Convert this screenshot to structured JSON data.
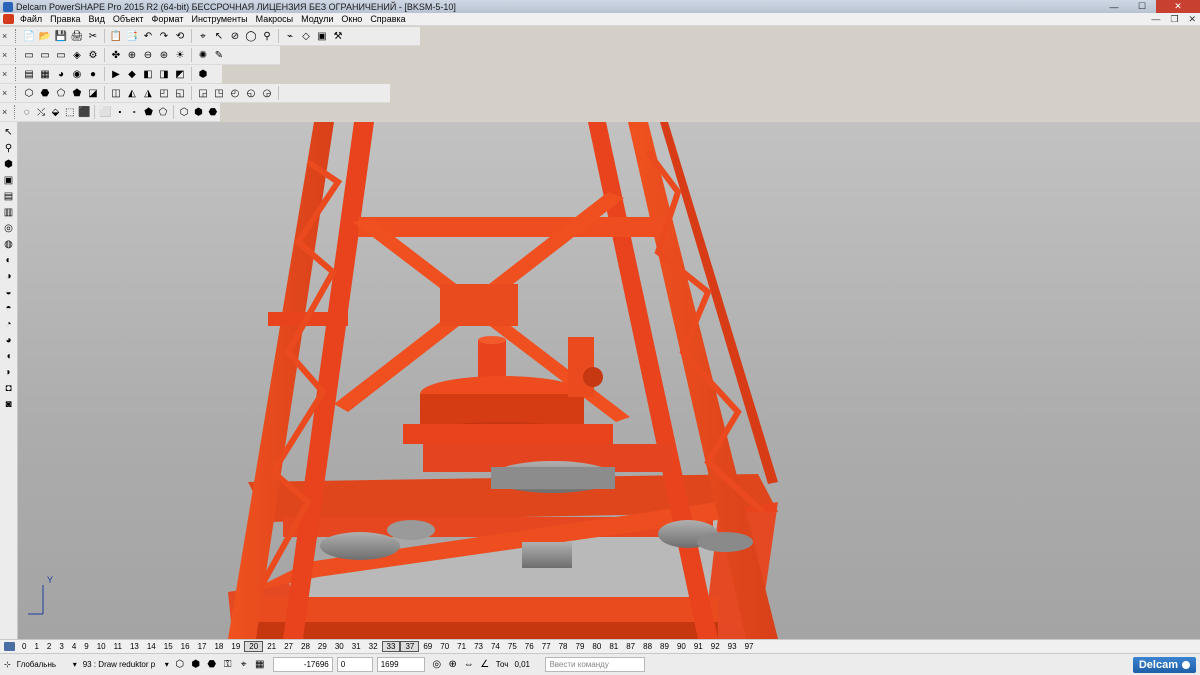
{
  "window": {
    "title": "Delcam PowerSHAPE Pro 2015 R2 (64-bit) БЕССРОЧНАЯ ЛИЦЕНЗИЯ БЕЗ ОГРАНИЧЕНИЙ - [BKSM-5-10]",
    "minimize": "—",
    "maximize": "☐",
    "close": "✕"
  },
  "menu": {
    "items": [
      "Файл",
      "Правка",
      "Вид",
      "Объект",
      "Формат",
      "Инструменты",
      "Макросы",
      "Модули",
      "Окно",
      "Справка"
    ],
    "mdi": [
      "—",
      "❐",
      "✕"
    ]
  },
  "toolbars": {
    "close_glyph": "×",
    "row1": [
      "📄",
      "📂",
      "💾",
      "🖨",
      "✂",
      "📋",
      "📑",
      "↶",
      "↷",
      "⟲",
      "⌖",
      "↖",
      "⊘",
      "◯",
      "⚲",
      "⌁",
      "◇",
      "▣",
      "⚒"
    ],
    "row2": [
      "▭",
      "▭",
      "▭",
      "◈",
      "⚙",
      "✤",
      "⊕",
      "⊖",
      "⊛",
      "☀",
      "✺",
      "✎"
    ],
    "row3": [
      "▤",
      "▦",
      "◕",
      "◉",
      "●",
      "▶",
      "◆",
      "◧",
      "◨",
      "◩",
      "⬢"
    ],
    "row4": [
      "⬡",
      "⬣",
      "⬠",
      "⬟",
      "◪",
      "◫",
      "◭",
      "◮",
      "◰",
      "◱",
      "◲",
      "◳",
      "◴",
      "◵",
      "◶"
    ],
    "row5": [
      "◌",
      "⤯",
      "⬙",
      "⬚",
      "⬛",
      "⬜",
      "⬝",
      "⬞",
      "⬟",
      "⬠",
      "⬡",
      "⬢",
      "⬣"
    ]
  },
  "left_toolbar": [
    "↖",
    "⚲",
    "⬢",
    "▣",
    "▤",
    "▥",
    "◎",
    "◍",
    "◐",
    "◑",
    "◒",
    "◓",
    "◔",
    "◕",
    "◖",
    "◗",
    "◘",
    "◙"
  ],
  "viewport": {
    "axis_label": "Y"
  },
  "levels": {
    "items": [
      "0",
      "1",
      "2",
      "3",
      "4",
      "9",
      "10",
      "11",
      "13",
      "14",
      "15",
      "16",
      "17",
      "18",
      "19",
      "20",
      "21",
      "27",
      "28",
      "29",
      "30",
      "31",
      "32",
      "33",
      "37",
      "69",
      "70",
      "71",
      "73",
      "74",
      "75",
      "76",
      "77",
      "78",
      "79",
      "80",
      "81",
      "87",
      "88",
      "89",
      "90",
      "91",
      "92",
      "93",
      "97"
    ],
    "active": [
      "20",
      "33",
      "37"
    ]
  },
  "status": {
    "workplane": "Глобальнь",
    "level_select": "93 : Draw reduktor р",
    "x": "-17696",
    "y": "0",
    "z": "1699",
    "tolerance_label": "Точ",
    "tolerance": "0,01",
    "command_placeholder": "Ввести команду",
    "logo": "Delcam"
  },
  "colors": {
    "crane_red": "#e8431c",
    "crane_dark": "#b8320f",
    "steel_gray": "#8f8f8f"
  }
}
